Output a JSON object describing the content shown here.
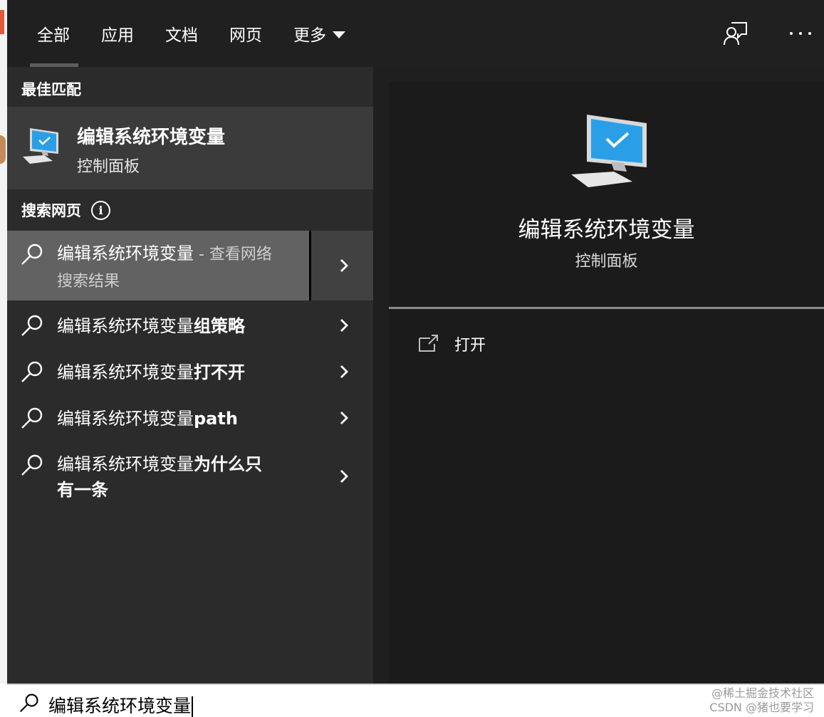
{
  "tabs": [
    {
      "label": "全部"
    },
    {
      "label": "应用"
    },
    {
      "label": "文档"
    },
    {
      "label": "网页"
    },
    {
      "label": "更多"
    }
  ],
  "best_match": {
    "header": "最佳匹配",
    "title": "编辑系统环境变量",
    "subtitle": "控制面板"
  },
  "web_search": {
    "header": "搜索网页",
    "items": [
      {
        "prefix": "编辑系统环境变量",
        "suffix": " - 查看网络",
        "line2": "搜索结果"
      },
      {
        "prefix": "编辑系统环境变量",
        "bold": "组策略"
      },
      {
        "prefix": "编辑系统环境变量",
        "bold": "打不开"
      },
      {
        "prefix": "编辑系统环境变量",
        "bold": "path"
      },
      {
        "prefix": "编辑系统环境变量",
        "bold": "为什么只",
        "bold2": "有一条"
      }
    ]
  },
  "preview": {
    "title": "编辑系统环境变量",
    "subtitle": "控制面板",
    "action_open": "打开"
  },
  "search": {
    "query": "编辑系统环境变量"
  },
  "watermark": {
    "line1": "@稀土掘金技术社区",
    "line2": "CSDN @猪也要学习"
  },
  "colors": {
    "accent_blue": "#2a9fe8",
    "panel_bg": "#2b2b2b",
    "selected_bg": "#626262"
  }
}
